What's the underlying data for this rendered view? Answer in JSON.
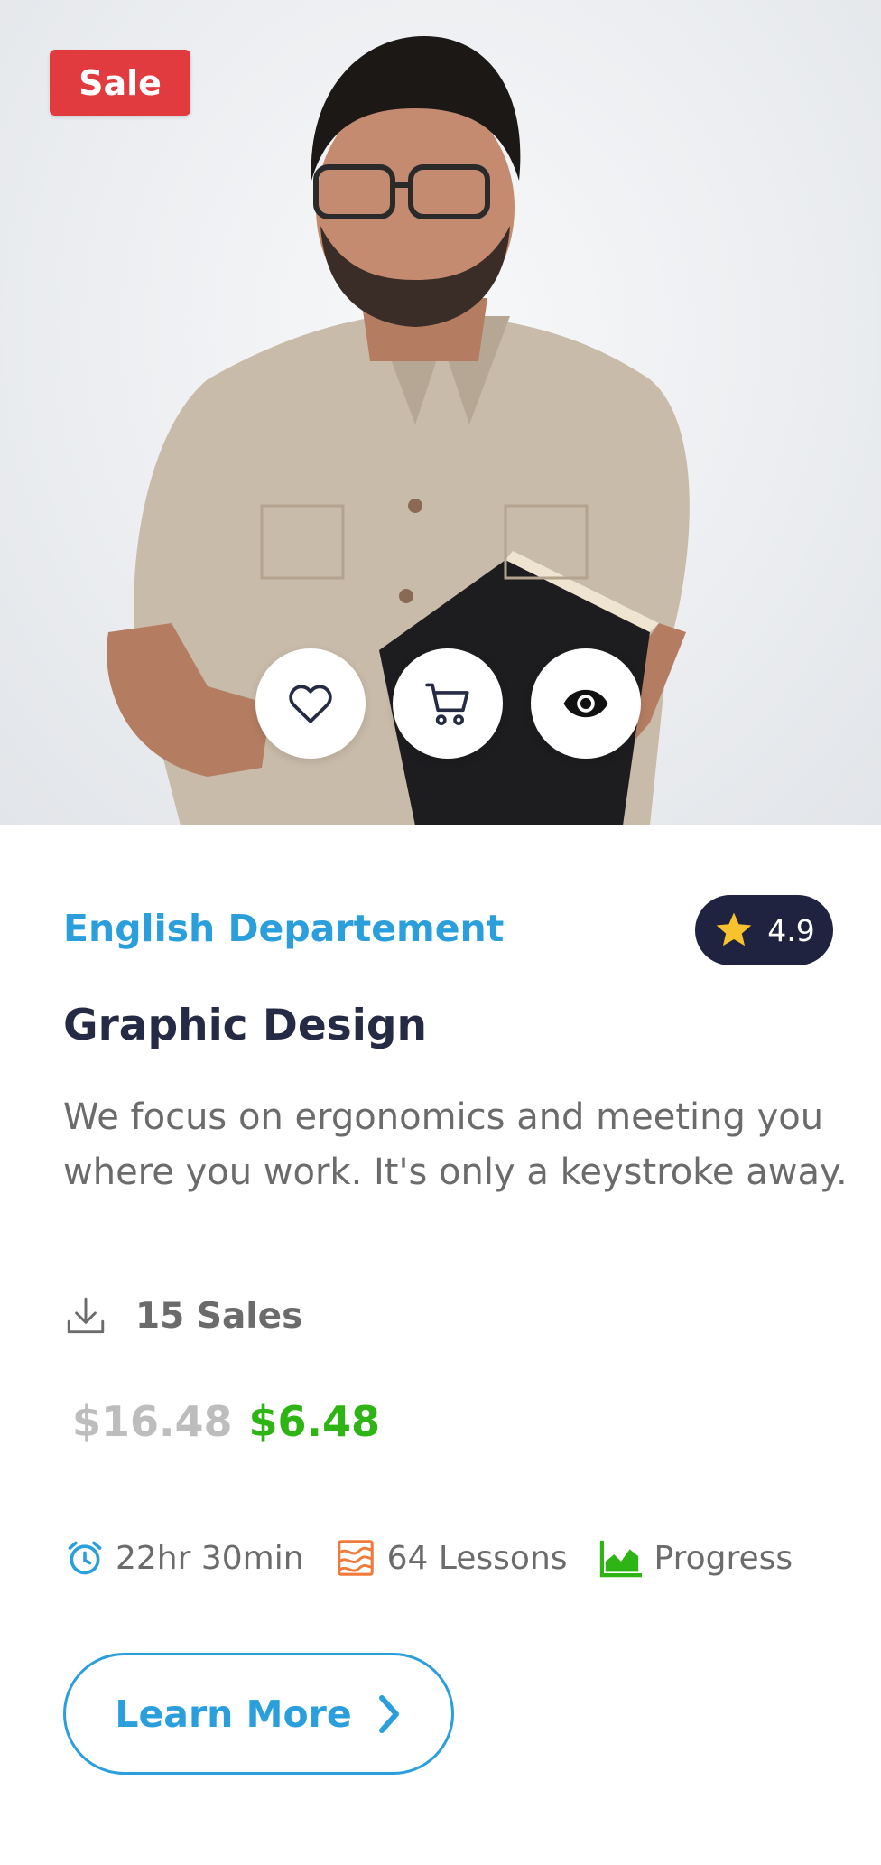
{
  "card": {
    "badge": "Sale",
    "department": "English Departement",
    "rating": "4.9",
    "title": "Graphic Design",
    "description": "We focus on ergonomics and meeting you where you work. It's only a keystroke away.",
    "sales": "15 Sales",
    "old_price": "$16.48",
    "new_price": "$6.48",
    "meta": {
      "duration": "22hr 30min",
      "lessons": "64 Lessons",
      "progress": "Progress"
    },
    "cta_label": "Learn More"
  },
  "icons": {
    "favorite": "heart-icon",
    "cart": "cart-icon",
    "view": "eye-icon",
    "rating": "star-icon",
    "sales": "download-icon",
    "duration": "alarm-clock-icon",
    "lessons": "layers-icon",
    "progress": "area-chart-icon",
    "cta": "chevron-right-icon"
  },
  "colors": {
    "accent": "#2a9fdc",
    "sale_badge": "#e23b3f",
    "rating_badge": "#1f2340",
    "star": "#f7c22e",
    "price_new": "#2fb416",
    "price_old": "#bdbdbd",
    "lessons_icon": "#ef7a3a",
    "progress_icon": "#2fb416"
  }
}
